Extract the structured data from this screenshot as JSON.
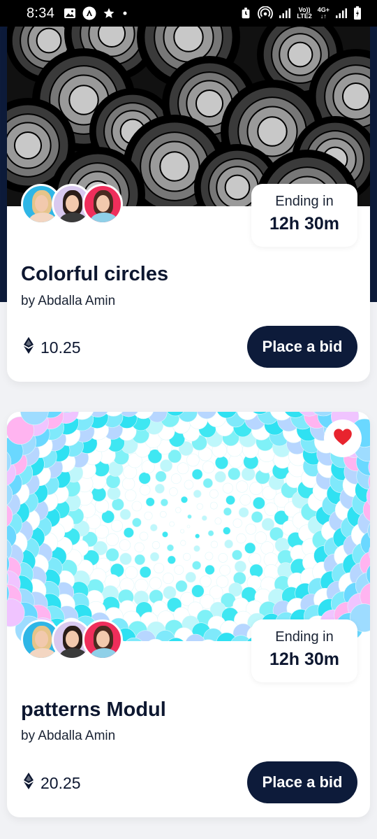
{
  "status_bar": {
    "time": "8:34",
    "left_icons": [
      "image-icon",
      "app-logo-icon",
      "star-icon",
      "dot-icon"
    ],
    "right_icons": [
      "alarm-icon",
      "hotspot-icon",
      "signal-icon",
      "volte-icon",
      "4g-icon",
      "signal-icon",
      "battery-icon"
    ],
    "volte_text_top": "Vo))",
    "volte_text_bottom": "LTE2",
    "net_text": "4G+"
  },
  "cards": [
    {
      "title": "Colorful circles",
      "author": "by Abdalla Amin",
      "ending_label": "Ending in",
      "ending_time": "12h 30m",
      "price": "10.25",
      "bid_label": "Place a bid",
      "image": "grayscale-concentric-circles-art",
      "favorite": false
    },
    {
      "title": "patterns Modul",
      "author": "by Abdalla Amin",
      "ending_label": "Ending in",
      "ending_time": "12h 30m",
      "price": "20.25",
      "bid_label": "Place a bid",
      "image": "cyan-pink-dot-spiral-art",
      "favorite": true
    }
  ],
  "colors": {
    "primary_dark": "#0d1b3a",
    "heart": "#e8242e",
    "background": "#f1f2f5"
  }
}
